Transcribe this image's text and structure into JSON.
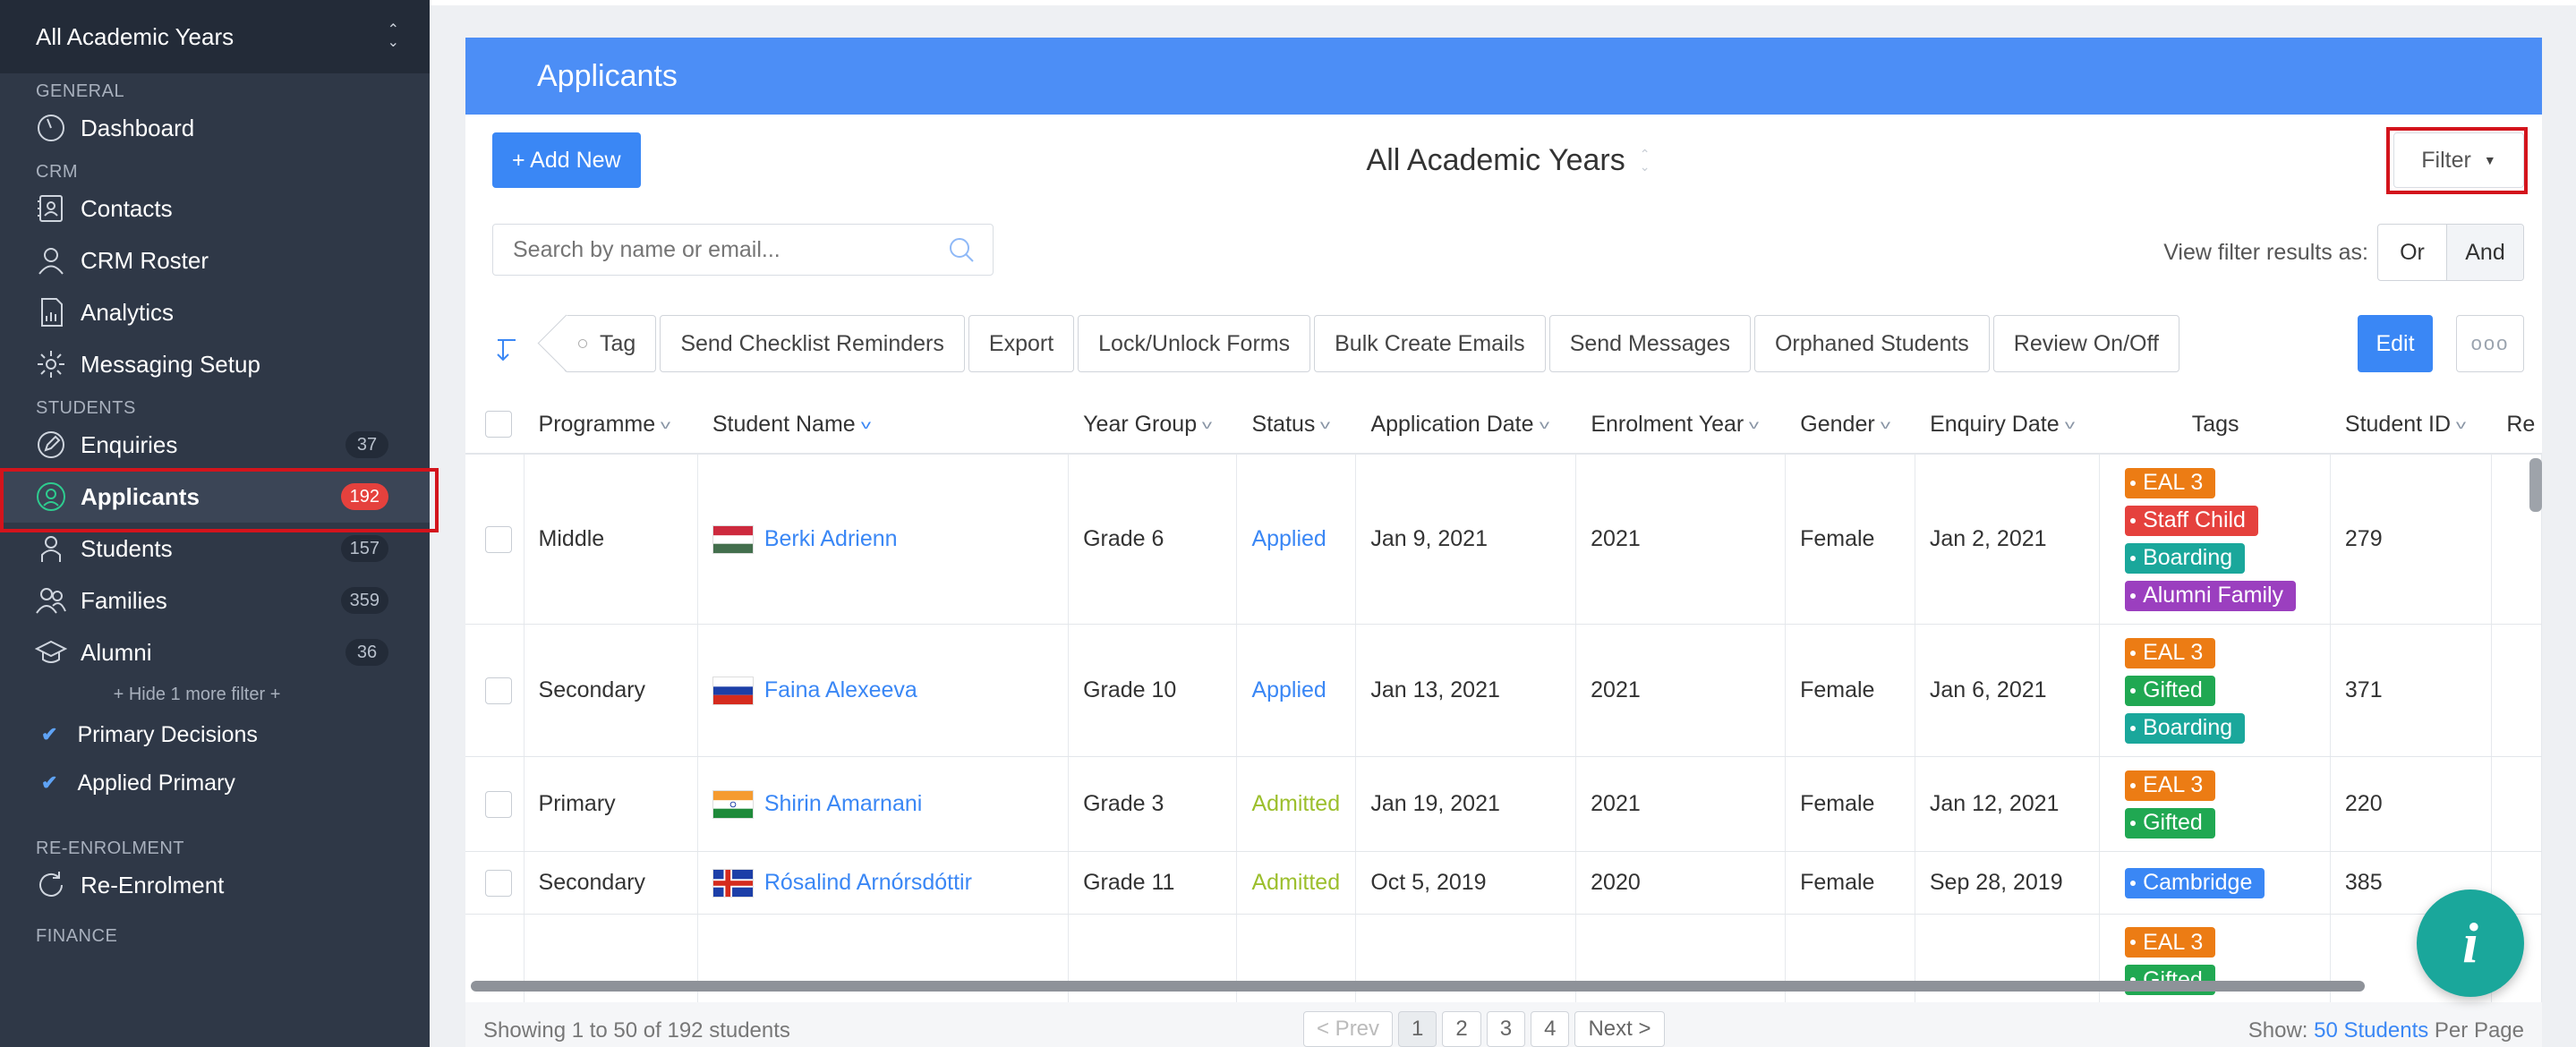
{
  "sidebar": {
    "year_selector": "All Academic Years",
    "sections": {
      "general": "GENERAL",
      "crm": "CRM",
      "students": "STUDENTS",
      "re_enrolment": "RE-ENROLMENT",
      "finance": "FINANCE"
    },
    "items": {
      "dashboard": {
        "label": "Dashboard",
        "icon": "dashboard-icon"
      },
      "contacts": {
        "label": "Contacts",
        "icon": "contacts-icon"
      },
      "crm_roster": {
        "label": "CRM Roster",
        "icon": "person-icon"
      },
      "analytics": {
        "label": "Analytics",
        "icon": "analytics-icon"
      },
      "messaging_setup": {
        "label": "Messaging Setup",
        "icon": "gear-icon"
      },
      "enquiries": {
        "label": "Enquiries",
        "count": "37",
        "icon": "pencil-icon"
      },
      "applicants": {
        "label": "Applicants",
        "count": "192",
        "icon": "person-circle-icon"
      },
      "students": {
        "label": "Students",
        "count": "157",
        "icon": "person-icon"
      },
      "families": {
        "label": "Families",
        "count": "359",
        "icon": "family-icon"
      },
      "alumni": {
        "label": "Alumni",
        "count": "36",
        "icon": "graduation-cap-icon"
      },
      "re_enrolment": {
        "label": "Re-Enrolment",
        "icon": "refresh-icon"
      }
    },
    "hide_more": "+ Hide 1 more filter +",
    "subfilters": [
      "Primary Decisions",
      "Applied Primary"
    ]
  },
  "main": {
    "title": "Applicants",
    "add_new": "+ Add New",
    "year": "All Academic Years",
    "filter": "Filter",
    "search_placeholder": "Search by name or email...",
    "view_as_label": "View filter results as:",
    "view_or": "Or",
    "view_and": "And",
    "toolbar": {
      "tag": "Tag",
      "send_checklist": "Send Checklist Reminders",
      "export": "Export",
      "lock_unlock": "Lock/Unlock Forms",
      "bulk_emails": "Bulk Create Emails",
      "send_messages": "Send Messages",
      "orphaned": "Orphaned Students",
      "review": "Review On/Off",
      "edit": "Edit",
      "more": "ooo"
    }
  },
  "table": {
    "headers": [
      "Programme",
      "Student Name",
      "Year Group",
      "Status",
      "Application Date",
      "Enrolment Year",
      "Gender",
      "Enquiry Date",
      "Tags",
      "Student ID",
      "Re"
    ],
    "rows": [
      {
        "programme": "Middle",
        "name": "Berki Adrienn",
        "flag": "hungary",
        "year_group": "Grade 6",
        "status": "Applied",
        "app_date": "Jan 9, 2021",
        "enrol_year": "2021",
        "gender": "Female",
        "enq_date": "Jan 2, 2021",
        "tags": [
          "EAL 3",
          "Staff Child",
          "Boarding",
          "Alumni Family"
        ],
        "student_id": "279"
      },
      {
        "programme": "Secondary",
        "name": "Faina Alexeeva",
        "flag": "russia",
        "year_group": "Grade 10",
        "status": "Applied",
        "app_date": "Jan 13, 2021",
        "enrol_year": "2021",
        "gender": "Female",
        "enq_date": "Jan 6, 2021",
        "tags": [
          "EAL 3",
          "Gifted",
          "Boarding"
        ],
        "student_id": "371"
      },
      {
        "programme": "Primary",
        "name": "Shirin Amarnani",
        "flag": "india",
        "year_group": "Grade 3",
        "status": "Admitted",
        "app_date": "Jan 19, 2021",
        "enrol_year": "2021",
        "gender": "Female",
        "enq_date": "Jan 12, 2021",
        "tags": [
          "EAL 3",
          "Gifted"
        ],
        "student_id": "220"
      },
      {
        "programme": "Secondary",
        "name": "Rósalind Arnórsdóttir",
        "flag": "iceland",
        "year_group": "Grade 11",
        "status": "Admitted",
        "app_date": "Oct 5, 2019",
        "enrol_year": "2020",
        "gender": "Female",
        "enq_date": "Sep 28, 2019",
        "tags": [
          "Cambridge"
        ],
        "student_id": "385"
      },
      {
        "tags": [
          "EAL 3",
          "Gifted"
        ]
      }
    ],
    "tag_colors": {
      "EAL 3": "#ec7c14",
      "Staff Child": "#e5413d",
      "Boarding": "#1aa79b",
      "Alumni Family": "#9b3fbf",
      "Gifted": "#20a852",
      "Cambridge": "#3a87f5"
    }
  },
  "footer": {
    "showing": "Showing 1 to 50 of 192 students",
    "prev": "< Prev",
    "pages": [
      "1",
      "2",
      "3",
      "4"
    ],
    "next": "Next >",
    "show_label": "Show:",
    "per_page_value": "50 Students",
    "per_page_suffix": "Per Page"
  },
  "fab": {
    "label": "i"
  }
}
